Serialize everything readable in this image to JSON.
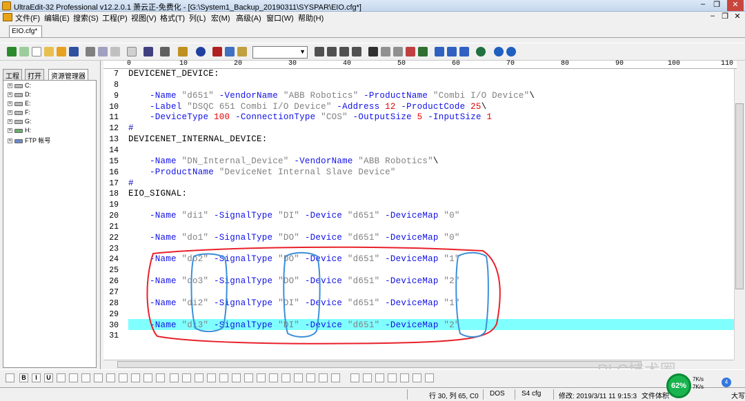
{
  "window": {
    "title": "UltraEdit-32 Professional v12.2.0.1 萧云正-免费化 - [G:\\System1_Backup_20190311\\SYSPAR\\EIO.cfg*]",
    "minimize": "–",
    "restore": "❐",
    "close": "✕",
    "doc_minimize": "–",
    "doc_restore": "❐",
    "doc_close": "✕"
  },
  "menu": [
    "文件(F)",
    "编辑(E)",
    "搜索(S)",
    "工程(P)",
    "视图(V)",
    "格式(T)",
    "列(L)",
    "宏(M)",
    "高级(A)",
    "窗口(W)",
    "帮助(H)"
  ],
  "file_tab": "EIO.cfg*",
  "side_panel": {
    "tabs": [
      "工程",
      "打开",
      "资源管理器"
    ],
    "tree": [
      {
        "expander": "+",
        "label": "C:"
      },
      {
        "expander": "+",
        "label": "D:"
      },
      {
        "expander": "+",
        "label": "E:"
      },
      {
        "expander": "+",
        "label": "F:"
      },
      {
        "expander": "+",
        "label": "G:"
      },
      {
        "expander": "+",
        "label": "H:"
      },
      {
        "expander": "+",
        "label": "FTP 帐号"
      }
    ]
  },
  "ruler": [
    "0",
    "10",
    "20",
    "30",
    "40",
    "50",
    "60",
    "70",
    "80",
    "90",
    "100",
    "110"
  ],
  "code_lines": [
    {
      "n": "7",
      "tokens": [
        {
          "t": "DEVICENET_DEVICE:",
          "c": ""
        }
      ]
    },
    {
      "n": "8",
      "tokens": []
    },
    {
      "n": "9",
      "tokens": [
        {
          "t": "    ",
          "c": ""
        },
        {
          "t": "-Name",
          "c": "kw"
        },
        {
          "t": " \"d651\" ",
          "c": "st"
        },
        {
          "t": "-VendorName",
          "c": "kw"
        },
        {
          "t": " \"ABB Robotics\" ",
          "c": "st"
        },
        {
          "t": "-ProductName",
          "c": "kw"
        },
        {
          "t": " \"Combi I/O Device\"",
          "c": "st"
        },
        {
          "t": "\\",
          "c": ""
        }
      ]
    },
    {
      "n": "10",
      "tokens": [
        {
          "t": "    ",
          "c": ""
        },
        {
          "t": "-Label",
          "c": "kw"
        },
        {
          "t": " \"DSQC 651 Combi I/O Device\" ",
          "c": "st"
        },
        {
          "t": "-Address",
          "c": "kw"
        },
        {
          "t": " ",
          "c": ""
        },
        {
          "t": "12",
          "c": "nm"
        },
        {
          "t": " ",
          "c": ""
        },
        {
          "t": "-ProductCode",
          "c": "kw"
        },
        {
          "t": " ",
          "c": ""
        },
        {
          "t": "25",
          "c": "nm"
        },
        {
          "t": "\\",
          "c": ""
        }
      ]
    },
    {
      "n": "11",
      "tokens": [
        {
          "t": "    ",
          "c": ""
        },
        {
          "t": "-DeviceType",
          "c": "kw"
        },
        {
          "t": " ",
          "c": ""
        },
        {
          "t": "100",
          "c": "nm"
        },
        {
          "t": " ",
          "c": ""
        },
        {
          "t": "-ConnectionType",
          "c": "kw"
        },
        {
          "t": " \"COS\" ",
          "c": "st"
        },
        {
          "t": "-OutputSize",
          "c": "kw"
        },
        {
          "t": " ",
          "c": ""
        },
        {
          "t": "5",
          "c": "nm"
        },
        {
          "t": " ",
          "c": ""
        },
        {
          "t": "-InputSize",
          "c": "kw"
        },
        {
          "t": " ",
          "c": ""
        },
        {
          "t": "1",
          "c": "nm"
        }
      ]
    },
    {
      "n": "12",
      "tokens": [
        {
          "t": "#",
          "c": "sy"
        }
      ]
    },
    {
      "n": "13",
      "tokens": [
        {
          "t": "DEVICENET_INTERNAL_DEVICE:",
          "c": ""
        }
      ]
    },
    {
      "n": "14",
      "tokens": []
    },
    {
      "n": "15",
      "tokens": [
        {
          "t": "    ",
          "c": ""
        },
        {
          "t": "-Name",
          "c": "kw"
        },
        {
          "t": " \"DN_Internal_Device\" ",
          "c": "st"
        },
        {
          "t": "-VendorName",
          "c": "kw"
        },
        {
          "t": " \"ABB Robotics\"",
          "c": "st"
        },
        {
          "t": "\\",
          "c": ""
        }
      ]
    },
    {
      "n": "16",
      "tokens": [
        {
          "t": "    ",
          "c": ""
        },
        {
          "t": "-ProductName",
          "c": "kw"
        },
        {
          "t": " \"DeviceNet Internal Slave Device\"",
          "c": "st"
        }
      ]
    },
    {
      "n": "17",
      "tokens": [
        {
          "t": "#",
          "c": "sy"
        }
      ]
    },
    {
      "n": "18",
      "tokens": [
        {
          "t": "EIO_SIGNAL:",
          "c": ""
        }
      ]
    },
    {
      "n": "19",
      "tokens": []
    },
    {
      "n": "20",
      "tokens": [
        {
          "t": "    ",
          "c": ""
        },
        {
          "t": "-Name",
          "c": "kw"
        },
        {
          "t": " \"di1\" ",
          "c": "st"
        },
        {
          "t": "-SignalType",
          "c": "kw"
        },
        {
          "t": " \"DI\" ",
          "c": "st"
        },
        {
          "t": "-Device",
          "c": "kw"
        },
        {
          "t": " \"d651\" ",
          "c": "st"
        },
        {
          "t": "-DeviceMap",
          "c": "kw"
        },
        {
          "t": " \"0\"",
          "c": "st"
        }
      ]
    },
    {
      "n": "21",
      "tokens": []
    },
    {
      "n": "22",
      "tokens": [
        {
          "t": "    ",
          "c": ""
        },
        {
          "t": "-Name",
          "c": "kw"
        },
        {
          "t": " \"do1\" ",
          "c": "st"
        },
        {
          "t": "-SignalType",
          "c": "kw"
        },
        {
          "t": " \"DO\" ",
          "c": "st"
        },
        {
          "t": "-Device",
          "c": "kw"
        },
        {
          "t": " \"d651\" ",
          "c": "st"
        },
        {
          "t": "-DeviceMap",
          "c": "kw"
        },
        {
          "t": " \"0\"",
          "c": "st"
        }
      ]
    },
    {
      "n": "23",
      "tokens": []
    },
    {
      "n": "24",
      "tokens": [
        {
          "t": "    ",
          "c": ""
        },
        {
          "t": "-Name",
          "c": "kw"
        },
        {
          "t": " \"do2\" ",
          "c": "st"
        },
        {
          "t": "-SignalType",
          "c": "kw"
        },
        {
          "t": " \"DO\" ",
          "c": "st"
        },
        {
          "t": "-Device",
          "c": "kw"
        },
        {
          "t": " \"d651\" ",
          "c": "st"
        },
        {
          "t": "-DeviceMap",
          "c": "kw"
        },
        {
          "t": " \"1\"",
          "c": "st"
        }
      ]
    },
    {
      "n": "25",
      "tokens": []
    },
    {
      "n": "26",
      "tokens": [
        {
          "t": "    ",
          "c": ""
        },
        {
          "t": "-Name",
          "c": "kw"
        },
        {
          "t": " \"do3\" ",
          "c": "st"
        },
        {
          "t": "-SignalType",
          "c": "kw"
        },
        {
          "t": " \"DO\" ",
          "c": "st"
        },
        {
          "t": "-Device",
          "c": "kw"
        },
        {
          "t": " \"d651\" ",
          "c": "st"
        },
        {
          "t": "-DeviceMap",
          "c": "kw"
        },
        {
          "t": " \"2\"",
          "c": "st"
        }
      ]
    },
    {
      "n": "27",
      "tokens": []
    },
    {
      "n": "28",
      "tokens": [
        {
          "t": "    ",
          "c": ""
        },
        {
          "t": "-Name",
          "c": "kw"
        },
        {
          "t": " \"di2\" ",
          "c": "st"
        },
        {
          "t": "-SignalType",
          "c": "kw"
        },
        {
          "t": " \"DI\" ",
          "c": "st"
        },
        {
          "t": "-Device",
          "c": "kw"
        },
        {
          "t": " \"d651\" ",
          "c": "st"
        },
        {
          "t": "-DeviceMap",
          "c": "kw"
        },
        {
          "t": " \"1\"",
          "c": "st"
        }
      ]
    },
    {
      "n": "29",
      "tokens": []
    },
    {
      "n": "30",
      "tokens": [
        {
          "t": "    ",
          "c": ""
        },
        {
          "t": "-Name",
          "c": "kw"
        },
        {
          "t": " \"di3\" ",
          "c": "st"
        },
        {
          "t": "-SignalType",
          "c": "kw"
        },
        {
          "t": " \"DI\" ",
          "c": "st"
        },
        {
          "t": "-Device",
          "c": "kw"
        },
        {
          "t": " \"d651\" ",
          "c": "st"
        },
        {
          "t": "-DeviceMap",
          "c": "kw"
        },
        {
          "t": " \"2\"",
          "c": "st"
        }
      ]
    },
    {
      "n": "31",
      "tokens": []
    }
  ],
  "current_line": "30",
  "colors": {
    "keyword": "#1010e8",
    "string": "#808080",
    "number": "#e80000",
    "line_highlight": "#80ffff",
    "annotation_red": "#e8202a",
    "annotation_blue": "#3b8fd8"
  },
  "status": {
    "position": "行 30, 列 65, C0",
    "line_ending": "DOS",
    "encoding": "S4 cfg",
    "modified": "修改: 2019/3/11 11 9:15:3",
    "file_size": "文件体积",
    "insert_mode": "大写"
  },
  "watermark": "PLC技术圈",
  "net_monitor": {
    "cpu": "62%",
    "up": "7K/s",
    "down": "7K/s",
    "badge": "4"
  }
}
